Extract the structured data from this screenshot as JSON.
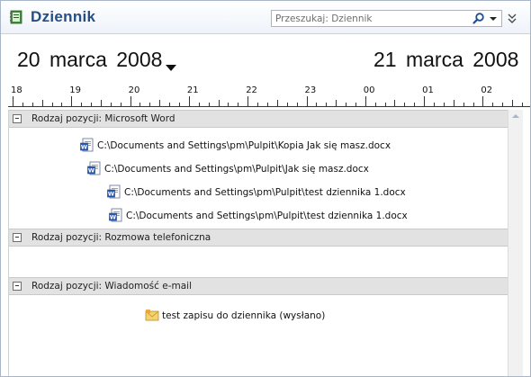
{
  "header": {
    "title": "Dziennik",
    "app_icon": "journal-icon",
    "search": {
      "placeholder": "Przeszukaj: Dziennik",
      "value": ""
    },
    "search_icon": "magnifier-icon",
    "dropdown_icon": "chevron-down-icon",
    "expand_icon": "double-chevron-down-icon"
  },
  "timeline": {
    "date_left": "20 marca 2008",
    "date_right": "21 marca 2008",
    "hours": [
      "18",
      "19",
      "20",
      "21",
      "22",
      "23",
      "00",
      "01",
      "02"
    ]
  },
  "groups": [
    {
      "label": "Rodzaj pozycji: Microsoft Word",
      "items": [
        {
          "label": "C:\\Documents and Settings\\pm\\Pulpit\\Kopia Jak się masz.docx",
          "icon": "word-document-icon"
        },
        {
          "label": "C:\\Documents and Settings\\pm\\Pulpit\\Jak się masz.docx",
          "icon": "word-document-icon"
        },
        {
          "label": "C:\\Documents and Settings\\pm\\Pulpit\\test dziennika 1.docx",
          "icon": "word-document-icon"
        },
        {
          "label": "C:\\Documents and Settings\\pm\\Pulpit\\test dziennika 1.docx",
          "icon": "word-document-icon"
        }
      ]
    },
    {
      "label": "Rodzaj pozycji: Rozmowa telefoniczna",
      "items": []
    },
    {
      "label": "Rodzaj pozycji: Wiadomość e-mail",
      "items": [
        {
          "label": "test zapisu do dziennika (wysłano)",
          "icon": "envelope-icon"
        }
      ]
    }
  ],
  "colors": {
    "title": "#254e86",
    "group_band": "#e2e2e2",
    "border": "#a9b6c8"
  }
}
